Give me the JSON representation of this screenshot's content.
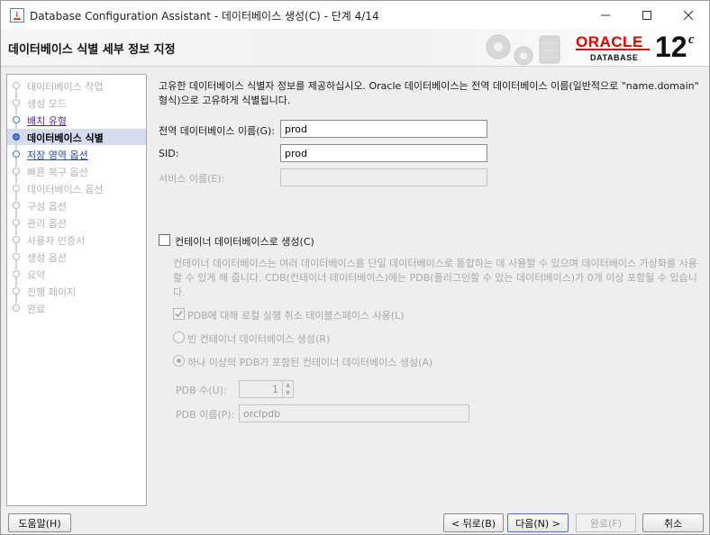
{
  "window": {
    "title": "Database Configuration Assistant - 데이터베이스 생성(C) - 단계 4/14"
  },
  "header": {
    "title": "데이터베이스 식별 세부 정보 지정",
    "brand": "ORACLE",
    "product": "DATABASE",
    "version": "12",
    "version_suffix": "c"
  },
  "steps": [
    {
      "label": "데이터베이스 작업",
      "state": "disabled"
    },
    {
      "label": "생성 모드",
      "state": "disabled"
    },
    {
      "label": "배치 유형",
      "state": "done"
    },
    {
      "label": "데이터베이스 식별",
      "state": "current"
    },
    {
      "label": "저장 영역 옵션",
      "state": "link"
    },
    {
      "label": "빠른 복구 옵션",
      "state": "disabled"
    },
    {
      "label": "데이터베이스 옵션",
      "state": "disabled"
    },
    {
      "label": "구성 옵션",
      "state": "disabled"
    },
    {
      "label": "관리 옵션",
      "state": "disabled"
    },
    {
      "label": "사용자 인증서",
      "state": "disabled"
    },
    {
      "label": "생성 옵션",
      "state": "disabled"
    },
    {
      "label": "요약",
      "state": "disabled"
    },
    {
      "label": "진행 페이지",
      "state": "disabled"
    },
    {
      "label": "완료",
      "state": "disabled"
    }
  ],
  "main": {
    "description": "고유한 데이터베이스 식별자 정보를 제공하십시오. Oracle 데이터베이스는 전역 데이터베이스 이름(일반적으로 \"name.domain\" 형식)으로 고유하게 식별됩니다.",
    "global_db_name_label": "전역 데이터베이스 이름(G):",
    "global_db_name_value": "prod",
    "sid_label": "SID:",
    "sid_value": "prod",
    "service_name_label": "서비스 이름(E):",
    "service_name_value": "",
    "container_db_label": "컨테이너 데이터베이스로 생성(C)",
    "container_db_checked": false,
    "container_description": "컨테이너 데이터베이스는 여러 데이터베이스를 단일 데이터베이스로 통합하는 데 사용할 수 있으며 데이터베이스 가상화를 사용할 수 있게 해 줍니다. CDB(컨테이너 데이터베이스)에는 PDB(플러그인할 수 있는 데이터베이스)가 0개 이상 포함될 수 있습니다.",
    "pdb_undo_label": "PDB에 대해 로컬 실행 취소 테이블스페이스 사용(L)",
    "pdb_undo_checked": true,
    "empty_container_label": "빈 컨테이너 데이터베이스 생성(R)",
    "with_pdb_label": "하나 이상의 PDB가 포함된 컨테이너 데이터베이스 생성(A)",
    "pdb_count_label": "PDB 수(U):",
    "pdb_count_value": "1",
    "pdb_name_label": "PDB 이름(P):",
    "pdb_name_value": "orclpdb"
  },
  "footer": {
    "help": "도움말(H)",
    "back": "< 뒤로(B)",
    "next": "다음(N) >",
    "finish": "완료(F)",
    "cancel": "취소"
  },
  "colors": {
    "oracle_red": "#e30000",
    "current_step_bg": "#d6dcef",
    "link_blue": "#2a4aa8"
  }
}
